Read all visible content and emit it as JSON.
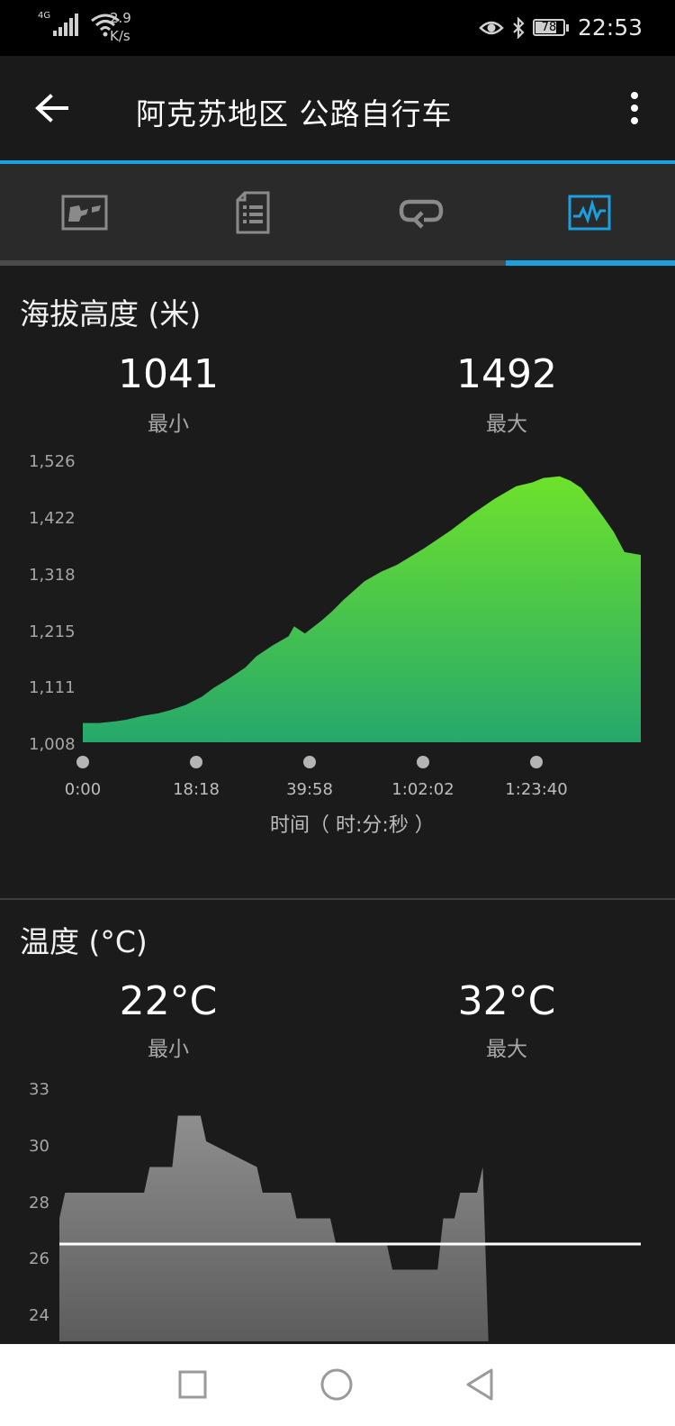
{
  "status_bar": {
    "network": "4G",
    "speed_value": "2.9",
    "speed_unit": "K/s",
    "battery": "78",
    "battery_level_percent": 78,
    "time": "22:53",
    "icons": [
      "signal-icon",
      "wifi-icon",
      "eye-icon",
      "bluetooth-icon",
      "battery-icon"
    ]
  },
  "app_bar": {
    "title": "阿克苏地区 公路自行车",
    "back_icon": "arrow-left-icon",
    "menu_icon": "more-vert-icon"
  },
  "tabs": [
    {
      "icon": "map-icon",
      "selected": false
    },
    {
      "icon": "document-icon",
      "selected": false
    },
    {
      "icon": "repeat-icon",
      "selected": false
    },
    {
      "icon": "chart-icon",
      "selected": true
    }
  ],
  "colors": {
    "accent": "#1a9fe0",
    "elevation_fill_top": "#6ee22b",
    "elevation_fill_bottom": "#25a86c",
    "temperature_fill": "#8a8a8a",
    "background": "#1b1b1b"
  },
  "elevation": {
    "title": "海拔高度 (米)",
    "min_value": "1041",
    "min_label": "最小",
    "max_value": "1492",
    "max_label": "最大"
  },
  "temperature": {
    "title": "温度 (°C)",
    "min_value": "22°C",
    "min_label": "最小",
    "max_value": "32°C",
    "max_label": "最大"
  },
  "chart_data": [
    {
      "type": "area",
      "y_tick_labels": [
        "1,526",
        "1,422",
        "1,318",
        "1,215",
        "1,111",
        "1,008"
      ],
      "ylim": [
        1008,
        1526
      ],
      "x_tick_labels": [
        "0:00",
        "18:18",
        "39:58",
        "1:02:02",
        "1:23:40"
      ],
      "xlabel": "时间（ 时:分:秒 ）",
      "ylabel": "",
      "xlim_minutes": [
        0,
        103
      ],
      "x_minutes": [
        0,
        3,
        6,
        8,
        11,
        14,
        16,
        19,
        22,
        24,
        27,
        30,
        32,
        35,
        38,
        39,
        41,
        44,
        46,
        48,
        52,
        55,
        58,
        63,
        68,
        72,
        76,
        80,
        83,
        85,
        88,
        90,
        92,
        94,
        96,
        98,
        100,
        103
      ],
      "values": [
        1043,
        1043,
        1046,
        1049,
        1056,
        1061,
        1066,
        1076,
        1091,
        1106,
        1124,
        1144,
        1164,
        1184,
        1201,
        1219,
        1206,
        1229,
        1246,
        1266,
        1301,
        1318,
        1331,
        1361,
        1394,
        1424,
        1451,
        1474,
        1481,
        1489,
        1492,
        1484,
        1471,
        1446,
        1419,
        1391,
        1354,
        1349
      ]
    },
    {
      "type": "area",
      "y_tick_labels": [
        "33",
        "30",
        "28",
        "26",
        "24"
      ],
      "ylim": [
        23,
        33
      ],
      "xlim_minutes": [
        0,
        103
      ],
      "reference_line": 27,
      "x_minutes": [
        0,
        1,
        15,
        16,
        20,
        21,
        25,
        26,
        35,
        36,
        41,
        42,
        48,
        49,
        58,
        59,
        67,
        68,
        70,
        71,
        74,
        75,
        76,
        77,
        103
      ],
      "values": [
        28,
        29,
        29,
        30,
        30,
        32,
        32,
        31,
        30,
        29,
        29,
        28,
        28,
        27,
        27,
        26,
        26,
        28,
        28,
        29,
        29,
        30,
        22,
        22,
        22
      ]
    }
  ]
}
